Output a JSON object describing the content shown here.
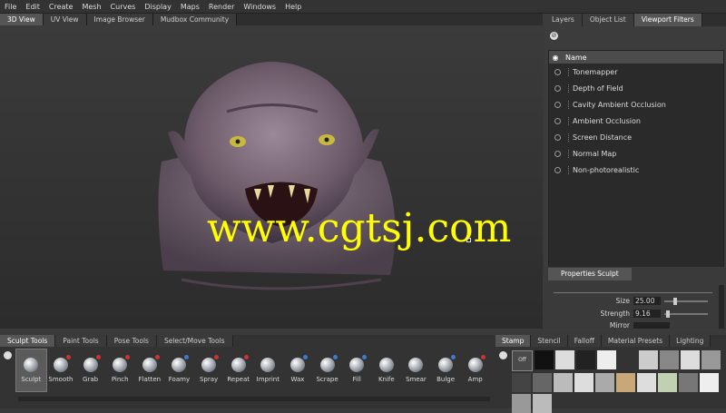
{
  "menu": [
    "File",
    "Edit",
    "Create",
    "Mesh",
    "Curves",
    "Display",
    "Maps",
    "Render",
    "Windows",
    "Help"
  ],
  "view_tabs": [
    "3D View",
    "UV View",
    "Image Browser",
    "Mudbox Community"
  ],
  "right_tabs": [
    "Layers",
    "Object List",
    "Viewport Filters"
  ],
  "filters": {
    "header": "Name",
    "items": [
      "Tonemapper",
      "Depth of Field",
      "Cavity Ambient Occlusion",
      "Ambient Occlusion",
      "Screen Distance",
      "Normal Map",
      "Non-photorealistic"
    ]
  },
  "watermark": "www.cgtsj.com",
  "properties": {
    "tab": "Properties Sculpt",
    "size_label": "Size",
    "size_value": "25.00",
    "strength_label": "Strength",
    "strength_value": "9.16",
    "mirror_label": "Mirror"
  },
  "tool_tabs": [
    "Sculpt Tools",
    "Paint Tools",
    "Pose Tools",
    "Select/Move Tools"
  ],
  "tools": [
    "Sculpt",
    "Smooth",
    "Grab",
    "Pinch",
    "Flatten",
    "Foamy",
    "Spray",
    "Repeat",
    "Imprint",
    "Wax",
    "Scrape",
    "Fill",
    "Knife",
    "Smear",
    "Bulge",
    "Amp"
  ],
  "stamp_tabs": [
    "Stamp",
    "Stencil",
    "Falloff",
    "Material Presets",
    "Lighting"
  ],
  "stamp_off_label": "Off",
  "colors": {
    "watermark": "#ffff00",
    "accent": "#555555",
    "background": "#3a3a3a"
  }
}
